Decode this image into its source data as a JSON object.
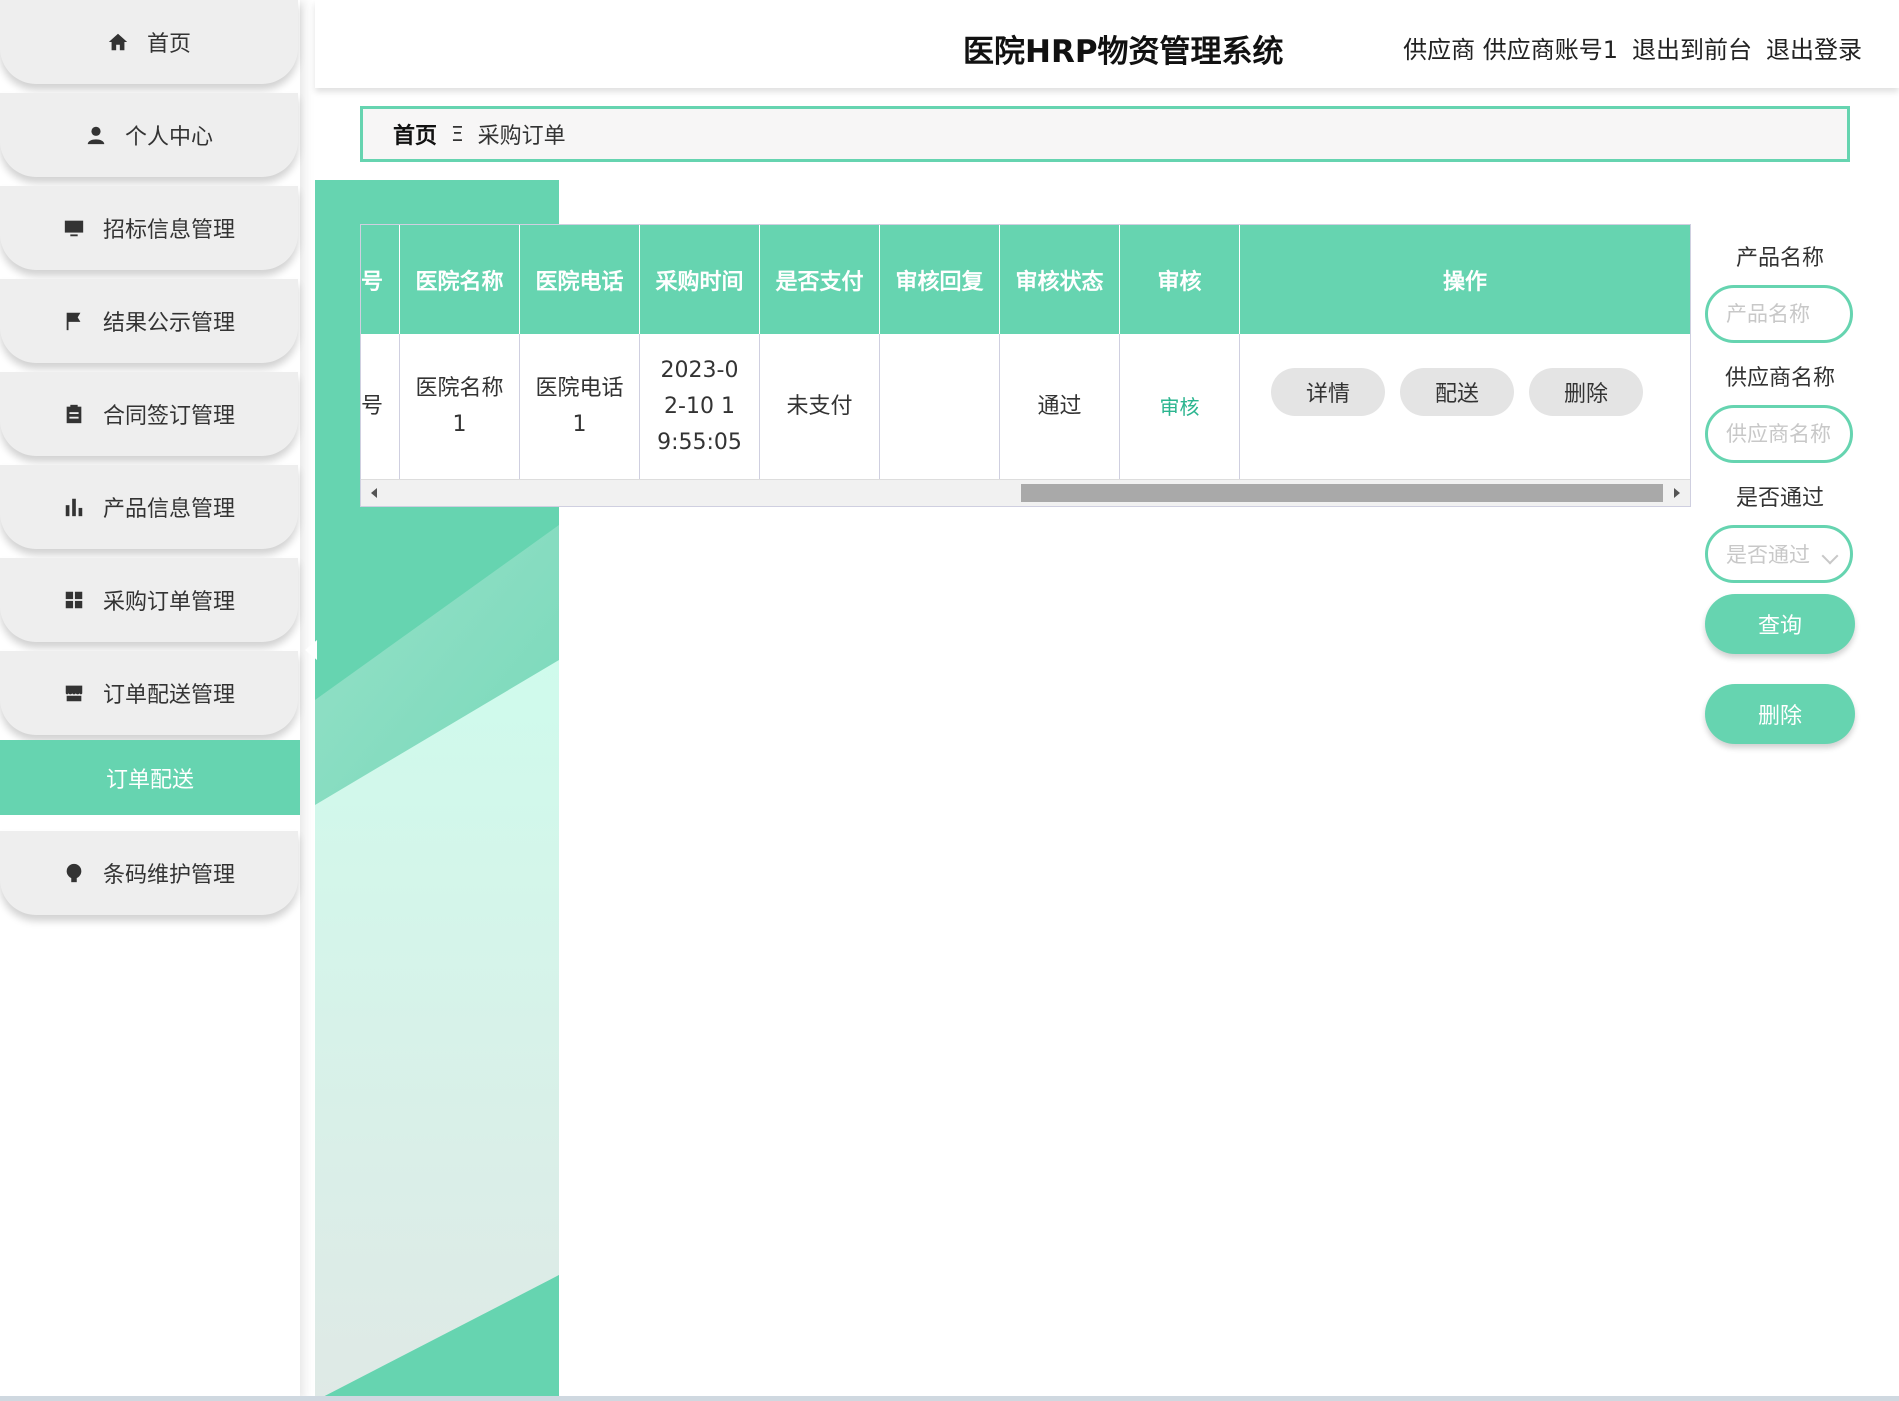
{
  "header": {
    "title": "医院HRP物资管理系统",
    "role": "供应商",
    "username": "供应商账号1",
    "exit_front": "退出到前台",
    "logout": "退出登录"
  },
  "sidebar": {
    "items": [
      {
        "label": "首页",
        "icon": "home-icon"
      },
      {
        "label": "个人中心",
        "icon": "person-icon"
      },
      {
        "label": "招标信息管理",
        "icon": "monitor-icon"
      },
      {
        "label": "结果公示管理",
        "icon": "flag-icon"
      },
      {
        "label": "合同签订管理",
        "icon": "clipboard-icon"
      },
      {
        "label": "产品信息管理",
        "icon": "bar-chart-icon"
      },
      {
        "label": "采购订单管理",
        "icon": "grid-icon"
      },
      {
        "label": "订单配送管理",
        "icon": "store-icon"
      },
      {
        "label": "条码维护管理",
        "icon": "bulb-icon"
      }
    ],
    "active_sub": "订单配送"
  },
  "breadcrumb": {
    "home": "首页",
    "separator": "Ξ",
    "current": "采购订单"
  },
  "table": {
    "headers": [
      "号",
      "医院名称",
      "医院电话",
      "采购时间",
      "是否支付",
      "审核回复",
      "审核状态",
      "审核",
      "操作"
    ],
    "row": {
      "c0": "号",
      "hospital_name": "医院名称1",
      "hospital_phone": "医院电话1",
      "purchase_time": "2023-02-10 19:55:05",
      "paid": "未支付",
      "audit_reply": "",
      "audit_status": "通过",
      "audit_link": "审核",
      "actions": {
        "detail": "详情",
        "deliver": "配送",
        "delete": "删除"
      }
    }
  },
  "search": {
    "product_label": "产品名称",
    "product_placeholder": "产品名称",
    "supplier_label": "供应商名称",
    "supplier_placeholder": "供应商名称",
    "pass_label": "是否通过",
    "pass_placeholder": "是否通过",
    "query_btn": "查询",
    "delete_btn": "删除"
  },
  "colors": {
    "accent": "#66d4b0",
    "accent_text": "#2bb58f"
  }
}
